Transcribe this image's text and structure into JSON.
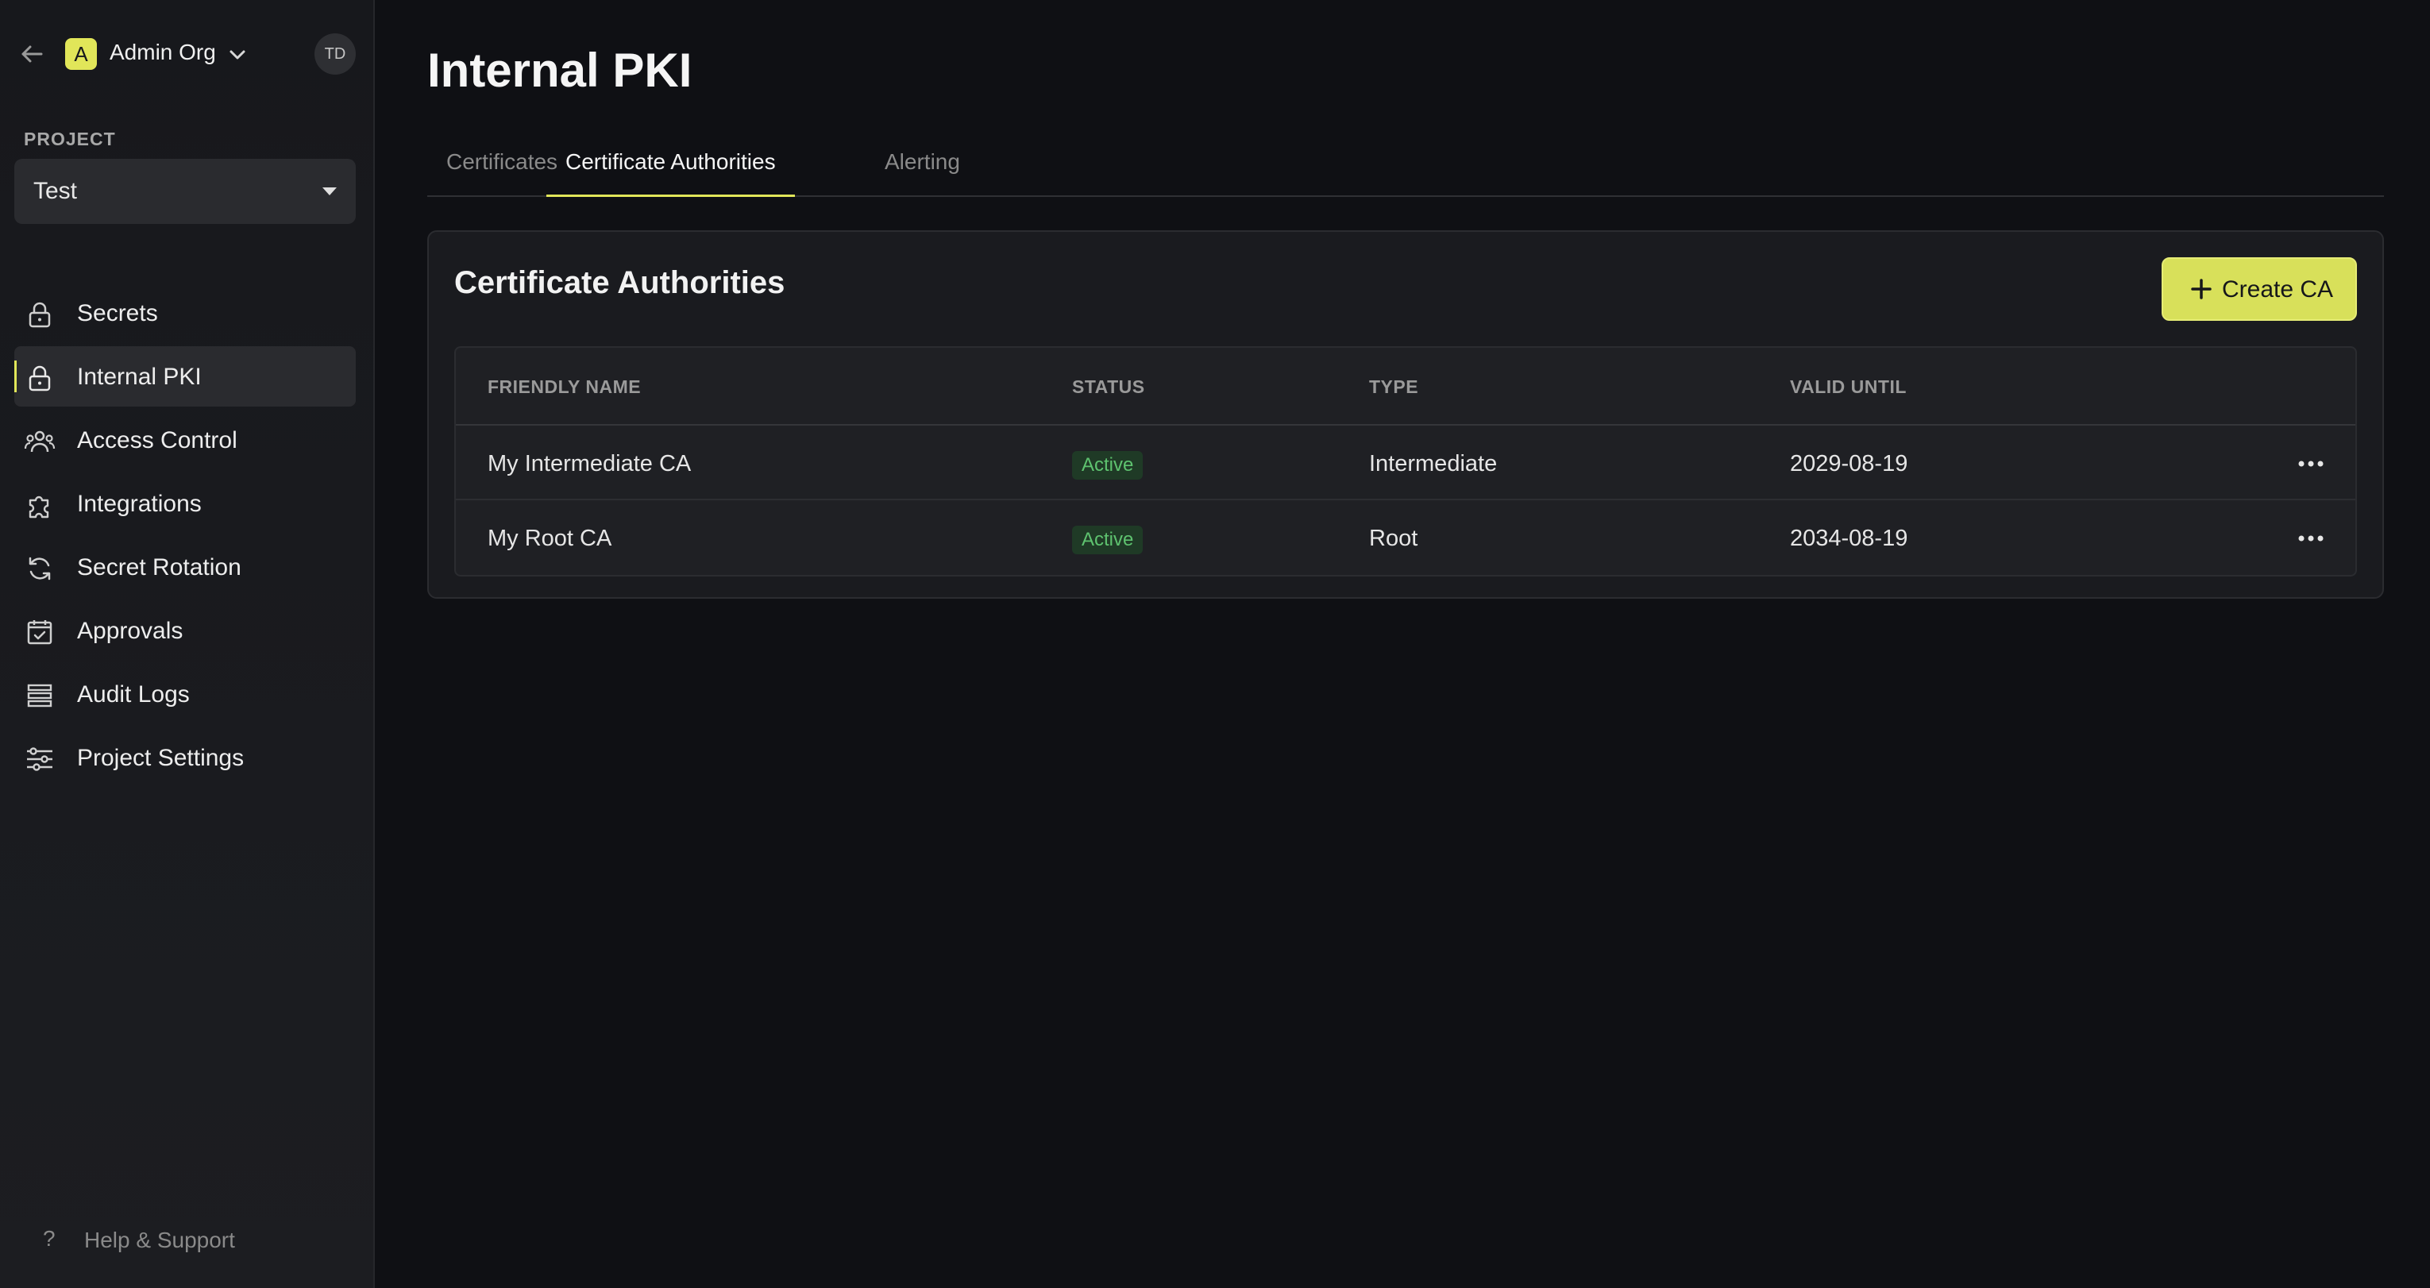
{
  "sidebar": {
    "org_badge_letter": "A",
    "org_name": "Admin Org",
    "user_initials": "TD",
    "project_label": "PROJECT",
    "project_value": "Test",
    "items": [
      {
        "label": "Secrets",
        "icon": "lock-icon"
      },
      {
        "label": "Internal PKI",
        "icon": "lock-icon",
        "active": true
      },
      {
        "label": "Access Control",
        "icon": "users-icon"
      },
      {
        "label": "Integrations",
        "icon": "puzzle-icon"
      },
      {
        "label": "Secret Rotation",
        "icon": "rotate-icon"
      },
      {
        "label": "Approvals",
        "icon": "calendar-check-icon"
      },
      {
        "label": "Audit Logs",
        "icon": "list-icon"
      },
      {
        "label": "Project Settings",
        "icon": "sliders-icon"
      }
    ],
    "help_label": "Help & Support",
    "help_icon": "?"
  },
  "main": {
    "title": "Internal PKI",
    "tabs": [
      {
        "label": "Certificates"
      },
      {
        "label": "Certificate Authorities",
        "active": true
      },
      {
        "label": "Alerting"
      }
    ],
    "card": {
      "title": "Certificate Authorities",
      "create_label": "Create CA",
      "columns": [
        "FRIENDLY NAME",
        "STATUS",
        "TYPE",
        "VALID UNTIL"
      ],
      "rows": [
        {
          "name": "My Intermediate CA",
          "status": "Active",
          "type": "Intermediate",
          "valid_until": "2029-08-19"
        },
        {
          "name": "My Root CA",
          "status": "Active",
          "type": "Root",
          "valid_until": "2034-08-19"
        }
      ]
    }
  },
  "colors": {
    "accent": "#e1e659",
    "background": "#0f1014",
    "status_active": "#5ec26f"
  }
}
